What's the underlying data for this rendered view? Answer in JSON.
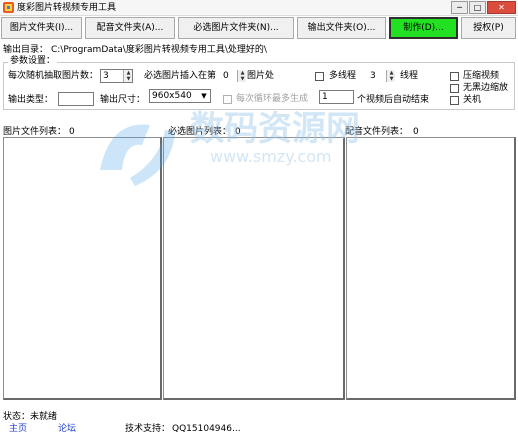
{
  "window": {
    "title": "度彩图片转视频专用工具",
    "min_glyph": "─",
    "max_glyph": "□",
    "close_glyph": "✕"
  },
  "toolbar": {
    "buttons": [
      {
        "label": "图片文件夹(I)..."
      },
      {
        "label": "配音文件夹(A)..."
      },
      {
        "label": "必选图片文件夹(N)..."
      },
      {
        "label": "输出文件夹(O)..."
      },
      {
        "label": "制作(D)..."
      },
      {
        "label": "授权(P)"
      }
    ]
  },
  "output_dir": {
    "label": "输出目录：",
    "path": "C:\\ProgramData\\度彩图片转视频专用工具\\处理好的\\"
  },
  "params": {
    "group_title": "参数设置：",
    "random_count_label": "每次随机抽取图片数：",
    "random_count_value": "3",
    "insert_prefix": "必选图片插入在第",
    "insert_value": "0",
    "insert_suffix": "图片处",
    "multithread_label": "多线程",
    "thread_count": "3",
    "thread_suffix": "线程",
    "compress_label": "压缩视频",
    "noborder_label": "无黑边缩放",
    "shutdown_label": "关机",
    "output_type_label": "输出类型：",
    "output_type_value": "",
    "output_size_label": "输出尺寸：",
    "output_size_value": "960x540",
    "cycle_label": "每次循环最多生成",
    "cycle_value": "1",
    "cycle_suffix": "个视频后自动结束"
  },
  "lists": {
    "images_label": "图片文件列表：",
    "images_count": "0",
    "required_label": "必选图片列表：",
    "required_count": "0",
    "audio_label": "配音文件列表：",
    "audio_count": "0"
  },
  "status": {
    "text": "状态：未就绪"
  },
  "footer": {
    "home": "主页",
    "forum": "论坛",
    "support_label": "技术支持：",
    "support_value": "QQ15104946..."
  },
  "watermark": {
    "text_cn": "数码资源网",
    "text_en": "www.smzy.com"
  },
  "colors": {
    "make_button": "#22e022",
    "close_button": "#d94c3e",
    "link": "#1a3fd1"
  }
}
